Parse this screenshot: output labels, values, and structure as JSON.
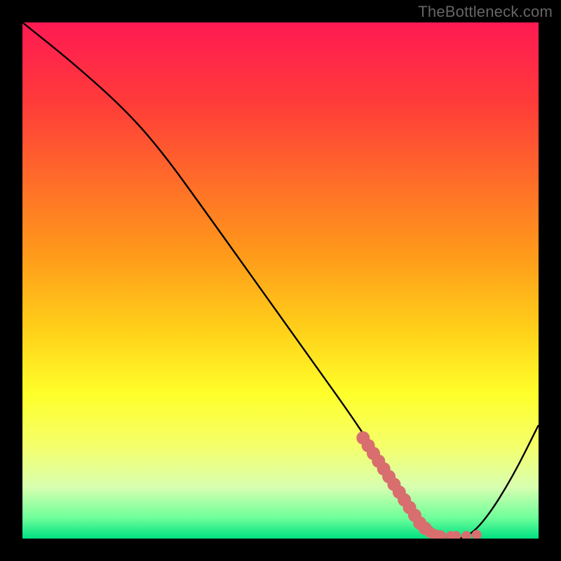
{
  "watermark": "TheBottleneck.com",
  "colors": {
    "frame": "#000000",
    "curve": "#000000",
    "dots": "#d86e6e",
    "gradient_stops": [
      {
        "offset": 0.0,
        "color": "#ff1a53"
      },
      {
        "offset": 0.15,
        "color": "#ff3a3a"
      },
      {
        "offset": 0.3,
        "color": "#ff6a2a"
      },
      {
        "offset": 0.45,
        "color": "#ff9a1a"
      },
      {
        "offset": 0.6,
        "color": "#ffd21a"
      },
      {
        "offset": 0.72,
        "color": "#ffff2a"
      },
      {
        "offset": 0.82,
        "color": "#f5ff6a"
      },
      {
        "offset": 0.9,
        "color": "#d8ffb0"
      },
      {
        "offset": 0.96,
        "color": "#6eff9a"
      },
      {
        "offset": 1.0,
        "color": "#00e082"
      }
    ]
  },
  "chart_data": {
    "type": "line",
    "title": "",
    "xlabel": "",
    "ylabel": "",
    "xlim": [
      0,
      100
    ],
    "ylim": [
      0,
      100
    ],
    "series": [
      {
        "name": "bottleneck-curve",
        "x": [
          0,
          10,
          20,
          27,
          35,
          45,
          55,
          65,
          70,
          74,
          78,
          82,
          86,
          90,
          95,
          100
        ],
        "y": [
          100,
          92,
          83,
          75,
          64,
          50,
          36,
          22,
          14,
          8,
          3,
          0,
          0,
          4,
          12,
          22
        ]
      }
    ],
    "highlight_dots": {
      "name": "optimal-range",
      "points": [
        {
          "x": 66,
          "y": 19.5
        },
        {
          "x": 67,
          "y": 18.0
        },
        {
          "x": 68,
          "y": 16.5
        },
        {
          "x": 69,
          "y": 15.0
        },
        {
          "x": 70,
          "y": 13.5
        },
        {
          "x": 71,
          "y": 12.0
        },
        {
          "x": 72,
          "y": 10.5
        },
        {
          "x": 73,
          "y": 9.0
        },
        {
          "x": 74,
          "y": 7.5
        },
        {
          "x": 75,
          "y": 6.0
        },
        {
          "x": 76,
          "y": 4.5
        },
        {
          "x": 77,
          "y": 3.0
        },
        {
          "x": 78,
          "y": 2.0
        },
        {
          "x": 79,
          "y": 1.2
        },
        {
          "x": 80,
          "y": 0.7
        },
        {
          "x": 81,
          "y": 0.5
        },
        {
          "x": 83,
          "y": 0.5
        },
        {
          "x": 84,
          "y": 0.5
        },
        {
          "x": 86,
          "y": 0.5
        },
        {
          "x": 88,
          "y": 0.7
        }
      ]
    }
  }
}
